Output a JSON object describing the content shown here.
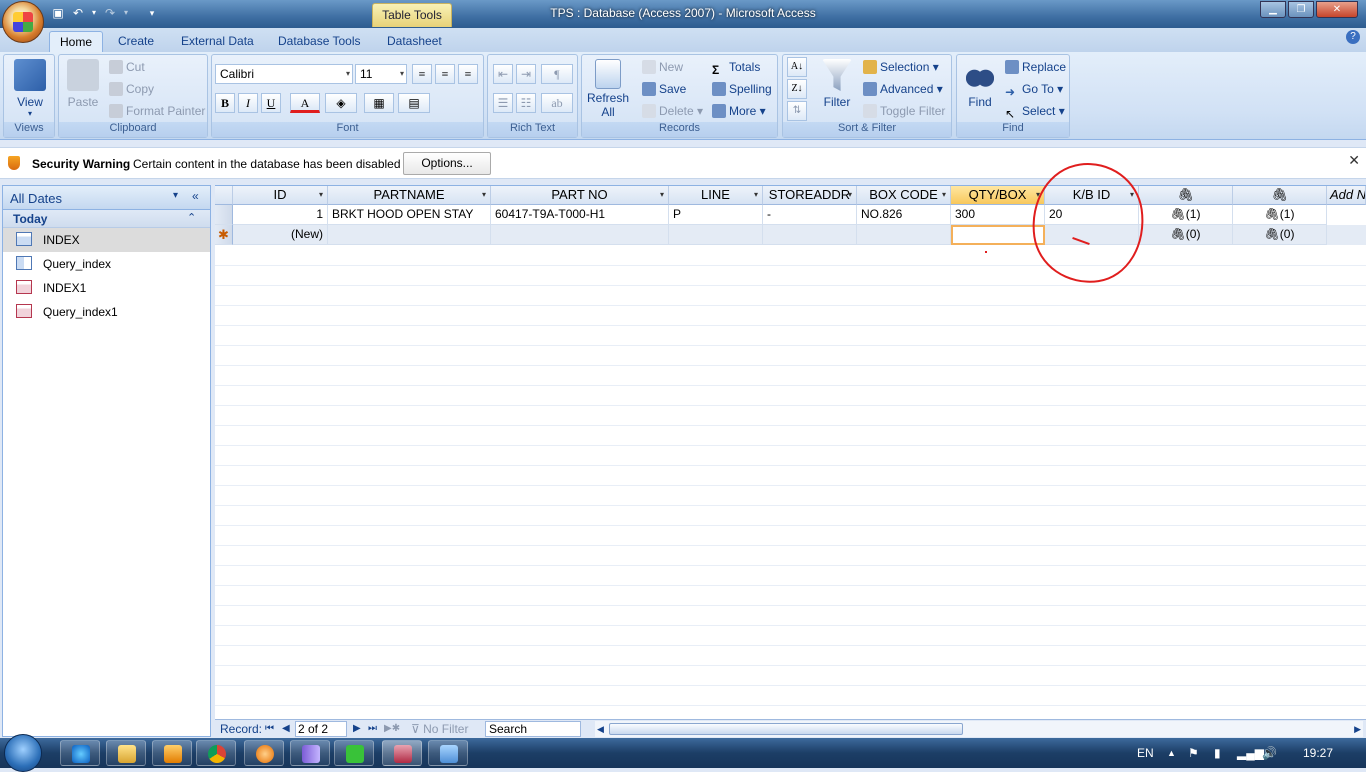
{
  "window": {
    "title": "TPS : Database (Access 2007) - Microsoft Access",
    "context_tab": "Table Tools"
  },
  "ribbon_tabs": [
    "Home",
    "Create",
    "External Data",
    "Database Tools",
    "Datasheet"
  ],
  "ribbon": {
    "views": {
      "label": "Views",
      "view": "View"
    },
    "clipboard": {
      "label": "Clipboard",
      "paste": "Paste",
      "cut": "Cut",
      "copy": "Copy",
      "format_painter": "Format Painter"
    },
    "font": {
      "label": "Font",
      "family": "Calibri",
      "size": "11",
      "bold": "B",
      "italic": "I",
      "underline": "U"
    },
    "rich_text": {
      "label": "Rich Text"
    },
    "records": {
      "label": "Records",
      "refresh_line1": "Refresh",
      "refresh_line2": "All",
      "new": "New",
      "save": "Save",
      "delete": "Delete",
      "totals": "Totals",
      "spelling": "Spelling",
      "more": "More"
    },
    "sort_filter": {
      "label": "Sort & Filter",
      "filter": "Filter",
      "selection": "Selection",
      "advanced": "Advanced",
      "toggle_filter": "Toggle Filter"
    },
    "find": {
      "label": "Find",
      "find": "Find",
      "replace": "Replace",
      "goto": "Go To",
      "select": "Select"
    }
  },
  "security": {
    "title": "Security Warning",
    "message": "Certain content in the database has been disabled",
    "options": "Options..."
  },
  "nav": {
    "header": "All Dates",
    "group": "Today",
    "items": [
      "INDEX",
      "Query_index",
      "INDEX1",
      "Query_index1"
    ]
  },
  "table": {
    "columns": [
      "ID",
      "PARTNAME",
      "PART NO",
      "LINE",
      "STOREADDR",
      "BOX CODE",
      "QTY/BOX",
      "K/B ID",
      "",
      "",
      "Add N"
    ],
    "rows": [
      {
        "id": "1",
        "partname": "BRKT HOOD OPEN STAY",
        "part_no": "60417-T9A-T000-H1",
        "line": "P",
        "storeaddr": "-",
        "box_code": "NO.826",
        "qty_box": "300",
        "kb_id": "20",
        "att1": "(1)",
        "att2": "(1)"
      }
    ],
    "new_row": {
      "id": "(New)",
      "att1": "(0)",
      "att2": "(0)"
    }
  },
  "record_nav": {
    "label": "Record:",
    "current": "2 of 2",
    "no_filter": "No Filter",
    "search": "Search"
  },
  "taskbar": {
    "lang": "EN",
    "time": "19:27"
  }
}
